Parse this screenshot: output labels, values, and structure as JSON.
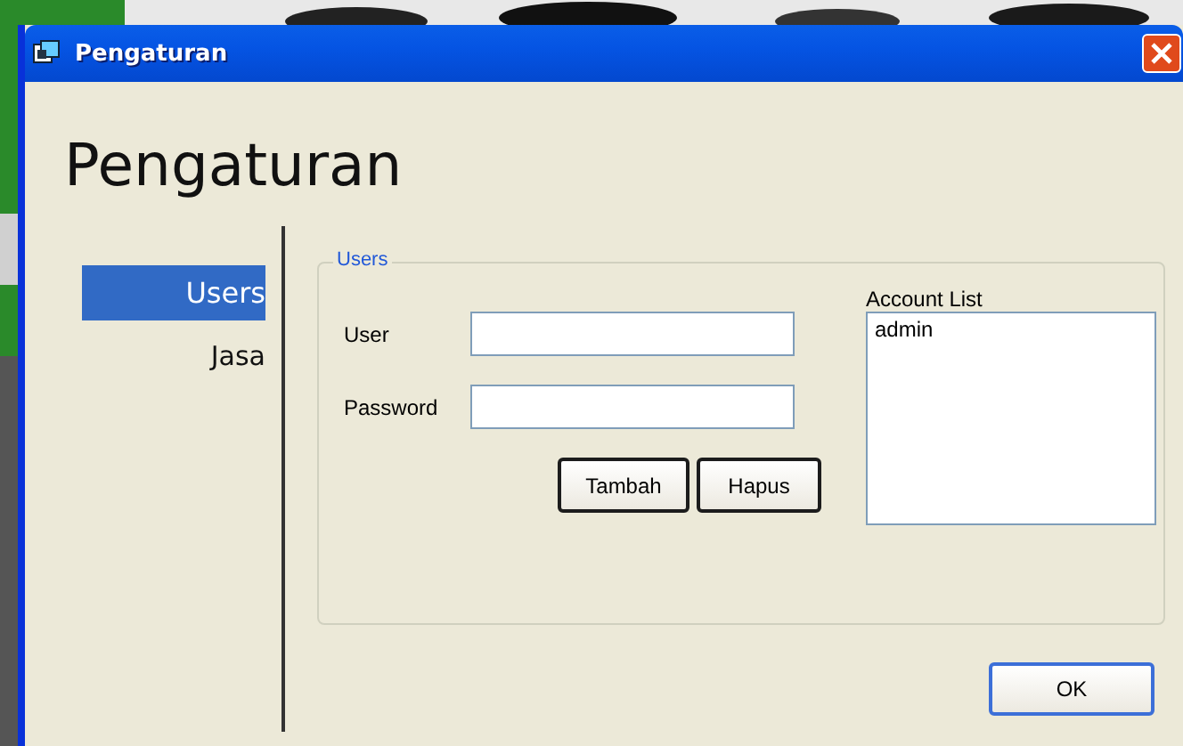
{
  "window": {
    "title": "Pengaturan"
  },
  "heading": "Pengaturan",
  "sidebar": {
    "items": [
      {
        "label": "Users",
        "selected": true
      },
      {
        "label": "Jasa",
        "selected": false
      }
    ]
  },
  "group": {
    "legend": "Users",
    "fields": [
      {
        "label": "User"
      },
      {
        "label": "Password"
      }
    ],
    "buttons": [
      "Tambah",
      "Hapus"
    ],
    "account_list": {
      "label": "Account List",
      "items": [
        {
          "label": "admin",
          "selected": false
        }
      ]
    }
  },
  "buttons": [
    "OK"
  ]
}
